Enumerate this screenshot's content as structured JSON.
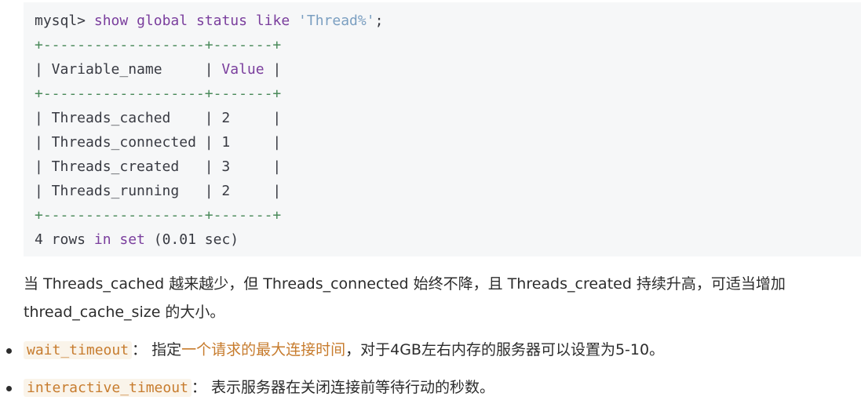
{
  "code": {
    "prompt": "mysql> ",
    "cmd_show": "show",
    "cmd_global": "global",
    "cmd_status": "status",
    "cmd_like": "like",
    "cmd_pattern": "'Thread%'",
    "cmd_semicolon": ";",
    "border": "+-------------------+-------+",
    "header_left": "| Variable_name     | ",
    "header_value": "Value",
    "header_right": " |",
    "rows": [
      {
        "text": "| Threads_cached    | 2     |"
      },
      {
        "text": "| Threads_connected | 1     |"
      },
      {
        "text": "| Threads_created   | 3     |"
      },
      {
        "text": "| Threads_running   | 2     |"
      }
    ],
    "footer_count": "4 rows ",
    "footer_in": "in",
    "footer_set": " set",
    "footer_rest": " (0.01 sec)"
  },
  "paragraph": "当 Threads_cached 越来越少，但 Threads_connected 始终不降，且 Threads_created 持续升高，可适当增加 thread_cache_size 的大小。",
  "bullets": [
    {
      "code": "wait_timeout",
      "sep": "： 指定",
      "highlight": "一个请求的最大连接时间",
      "rest": "，对于4GB左右内存的服务器可以设置为5-10。"
    },
    {
      "code": "interactive_timeout",
      "sep": "： 表示服务器在关闭连接前等待行动的秒数。",
      "highlight": "",
      "rest": ""
    }
  ]
}
